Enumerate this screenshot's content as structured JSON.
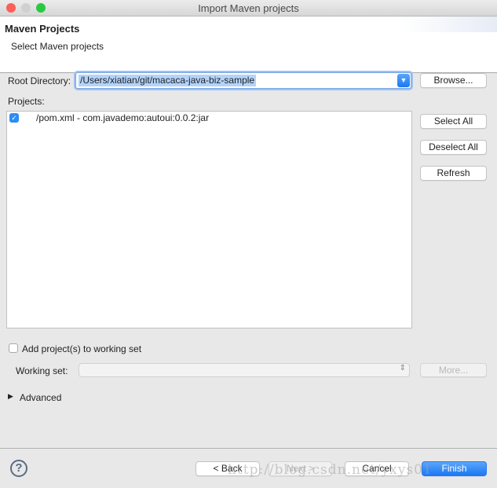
{
  "window": {
    "title": "Import Maven projects"
  },
  "header": {
    "title": "Maven Projects",
    "subtitle": "Select Maven projects"
  },
  "root": {
    "label": "Root Directory:",
    "value": "/Users/xiatian/git/macaca-java-biz-sample",
    "browse": "Browse..."
  },
  "projects": {
    "label": "Projects:",
    "items": [
      {
        "label": "/pom.xml - com.javademo:autoui:0.0.2:jar",
        "checked": true
      }
    ],
    "select_all": "Select All",
    "deselect_all": "Deselect All",
    "refresh": "Refresh"
  },
  "working_set": {
    "checkbox_label": "Add project(s) to working set",
    "checked": false,
    "label": "Working set:",
    "value": "",
    "more": "More..."
  },
  "advanced": {
    "label": "Advanced"
  },
  "footer": {
    "back": "< Back",
    "next": "Next >",
    "cancel": "Cancel",
    "finish": "Finish",
    "help": "?"
  },
  "watermark": "http://blog.csdn.net/yxys01",
  "colors": {
    "accent": "#1a78f2",
    "close": "#fc5f57",
    "minimize": "#d0d0d0",
    "maximize": "#2ac940"
  }
}
